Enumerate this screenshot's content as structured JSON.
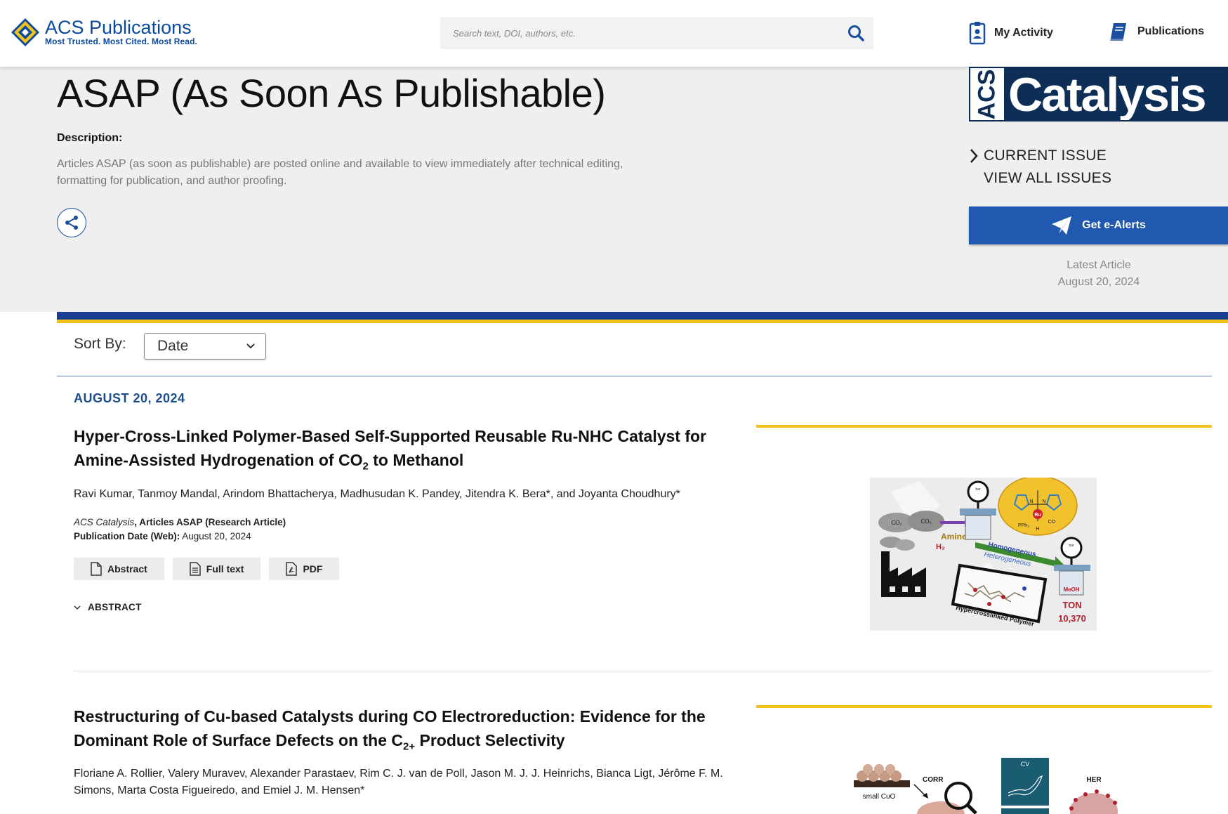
{
  "header": {
    "logo_name": "ACS Publications",
    "logo_tagline": "Most Trusted. Most Cited. Most Read.",
    "search_placeholder": "Search text, DOI, authors, etc.",
    "nav_my_activity": "My Activity",
    "nav_publications": "Publications"
  },
  "banner": {
    "title": "ASAP (As Soon As Publishable)",
    "description_label": "Description:",
    "description_text": "Articles ASAP (as soon as publishable) are posted online and available to view immediately after technical editing, formatting for publication, and author proofing.",
    "journal_logo_acs": "ACS",
    "journal_logo_name": "Catalysis",
    "current_issue": "CURRENT ISSUE",
    "view_all_issues": "VIEW ALL ISSUES",
    "alerts_label": "Get e-Alerts",
    "latest_label": "Latest Article",
    "latest_date": "August 20, 2024"
  },
  "sort": {
    "label": "Sort By:",
    "selected": "Date"
  },
  "listing": {
    "date_heading": "AUGUST 20, 2024",
    "articles": [
      {
        "title_before": "Hyper-Cross-Linked Polymer-Based Self-Supported Reusable Ru-NHC Catalyst for Amine-Assisted Hydrogenation of CO",
        "title_sub": "2",
        "title_after": " to Methanol",
        "authors": "Ravi Kumar, Tanmoy Mandal, Arindom Bhattacherya, Madhusudan K. Pandey, Jitendra K. Bera*, and Joyanta Choudhury*",
        "journal": "ACS Catalysis",
        "section": ", Articles ASAP (Research Article)",
        "pubdate_label": "Publication Date (Web):",
        "pubdate": " August 20, 2024",
        "btn_abstract": "Abstract",
        "btn_fulltext": "Full text",
        "btn_pdf": "PDF",
        "abstract_toggle": "ABSTRACT",
        "toc": {
          "co2_a": "CO₂",
          "co2_b": "CO₂",
          "amine": "Amine",
          "h2": "H₂",
          "homogeneous": "Homogeneous",
          "heterogeneous": "Heterogeneous",
          "polymer": "Hypercrosslinked Polymer",
          "meoh": "MeOH",
          "ton": "TON",
          "ton_value": "10,370",
          "ru": "Ru",
          "pph3": "PPh₃",
          "co": "CO",
          "h": "H",
          "n1": "N",
          "n2": "N",
          "gauge": "bar"
        }
      },
      {
        "title_before": "Restructuring of Cu-based Catalysts during CO Electroreduction: Evidence for the Dominant Role of Surface Defects on the C",
        "title_sub": "2+",
        "title_after": " Product Selectivity",
        "authors": "Floriane A. Rollier, Valery Muravev, Alexander Parastaev, Rim C. J. van de Poll, Jason M. J. J. Heinrichs, Bianca Ligt, Jérôme F. M. Simons, Marta Costa Figueiredo, and Emiel J. M. Hensen*",
        "toc": {
          "small_cuo": "small CuO",
          "corr": "CORR",
          "cv": "CV",
          "her": "HER"
        }
      }
    ]
  },
  "colors": {
    "acs_blue": "#0a4a9f",
    "navy": "#0d2f57",
    "button_blue": "#2158b0",
    "accent_yellow": "#f4c21b",
    "date_blue": "#1b4c8c"
  }
}
